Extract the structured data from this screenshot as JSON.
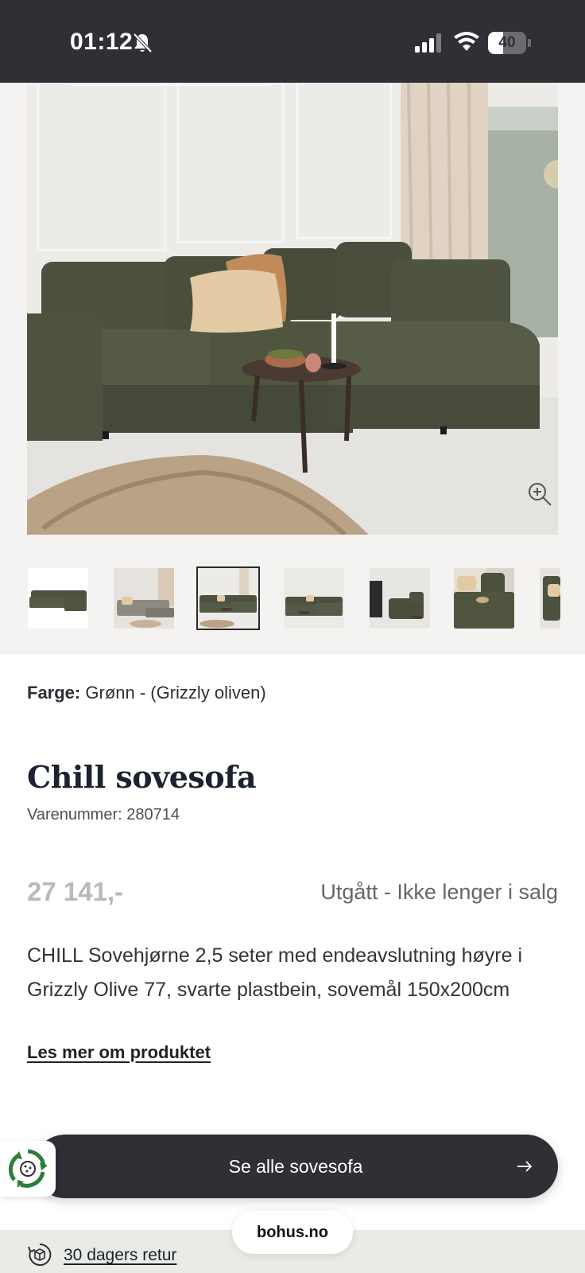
{
  "status_bar": {
    "time": "01:12",
    "battery": "40",
    "battery_level": 0.4
  },
  "gallery": {
    "thumbnail_count": 7,
    "active_thumbnail_index": 2
  },
  "product": {
    "color_label": "Farge:",
    "color_value": "Grønn - (Grizzly oliven)",
    "name": "Chill sovesofa",
    "sku": "Varenummer: 280714",
    "price": "27 141,-",
    "status": "Utgått - Ikke lenger i salg",
    "description": "CHILL Sovehjørne 2,5 seter med endeavslutning høyre i Grizzly Olive 77, svarte plastbein, sovemål 150x200cm",
    "more_link": "Les mer om produktet"
  },
  "cta": {
    "label": "Se alle sovesofa"
  },
  "footer": {
    "return_text": "30 dagers retur",
    "domain": "bohus.no"
  },
  "colors": {
    "dark": "#2f2f35",
    "sofa_green": "#4a4f3c",
    "footer_green": "#e8ebe6",
    "price_gray": "#b9b9bc"
  }
}
